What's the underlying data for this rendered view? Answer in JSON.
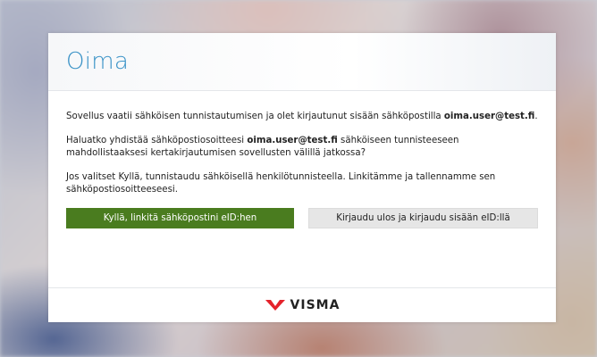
{
  "app": {
    "title": "Oima"
  },
  "message": {
    "p1_text": "Sovellus vaatii sähköisen tunnistautumisen ja olet kirjautunut sisään sähköpostilla ",
    "p1_email": "oima.user@test.fi",
    "p1_end": ".",
    "p2_start": "Haluatko yhdistää sähköpostiosoitteesi ",
    "p2_email": "oima.user@test.fi",
    "p2_end": " sähköiseen tunnisteeseen mahdollistaaksesi kertakirjautumisen sovellusten välillä jatkossa?",
    "p3": "Jos valitset Kyllä, tunnistaudu sähköisellä henkilötunnisteella. Linkitämme ja tallennamme sen sähköpostiosoitteeseesi."
  },
  "actions": {
    "confirm_label": "Kyllä, linkitä sähköpostini eID:hen",
    "logout_label": "Kirjaudu ulos ja kirjaudu sisään eID:llä"
  },
  "footer": {
    "brand": "VISMA",
    "brand_icon": "visma-chevron-icon",
    "brand_color": "#e4222b"
  },
  "colors": {
    "title": "#3b93c7",
    "primary_button": "#4a7c1f",
    "secondary_button": "#e6e6e6"
  }
}
